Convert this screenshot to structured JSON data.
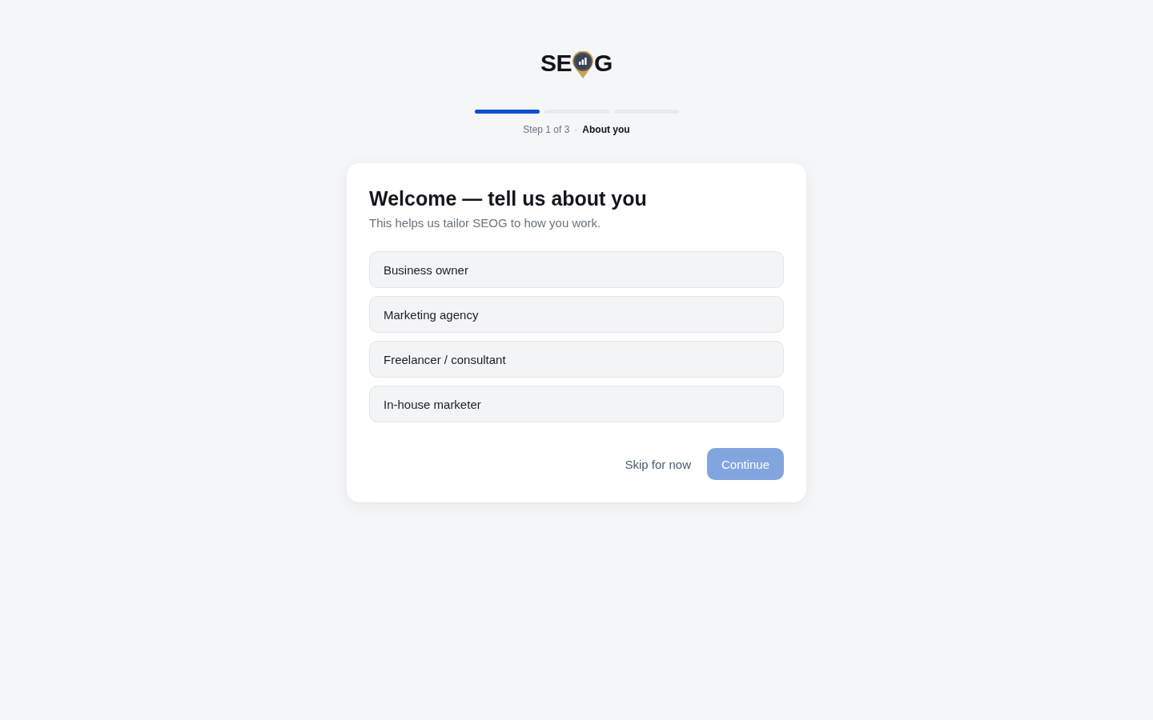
{
  "logo": {
    "text_before_icon": "SE",
    "text_after_icon": "G"
  },
  "progress": {
    "segments": [
      {
        "done": true
      },
      {
        "done": false
      },
      {
        "done": false
      }
    ],
    "step_label": "Step 1 of 3",
    "separator": "·",
    "step_name": "About you"
  },
  "card": {
    "title": "Welcome — tell us about you",
    "subtitle": "This helps us tailor SEOG to how you work.",
    "options": [
      {
        "label": "Business owner",
        "selected": false
      },
      {
        "label": "Marketing agency",
        "selected": false
      },
      {
        "label": "Freelancer / consultant",
        "selected": false
      },
      {
        "label": "In-house marketer",
        "selected": false
      }
    ],
    "skip_button": {
      "label": "Skip for now"
    },
    "continue_button": {
      "label": "Continue",
      "disabled": true
    }
  }
}
